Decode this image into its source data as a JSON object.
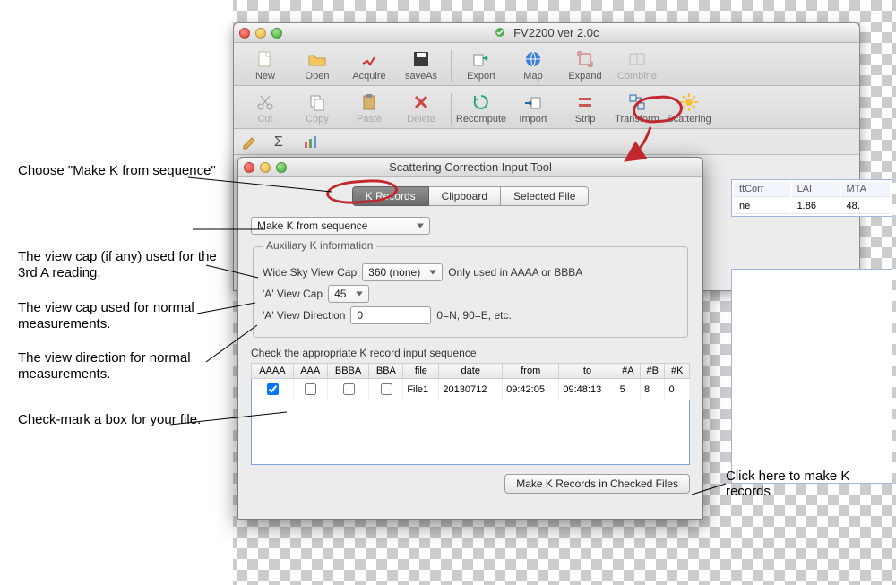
{
  "main_window": {
    "title": "FV2200 ver 2.0c",
    "toolbars": [
      [
        {
          "id": "new",
          "label": "New"
        },
        {
          "id": "open",
          "label": "Open"
        },
        {
          "id": "acquire",
          "label": "Acquire"
        },
        {
          "id": "saveAs",
          "label": "saveAs"
        },
        {
          "sep": true
        },
        {
          "id": "export",
          "label": "Export"
        },
        {
          "id": "map",
          "label": "Map"
        },
        {
          "id": "expand",
          "label": "Expand"
        },
        {
          "id": "combine",
          "label": "Combine",
          "disabled": true
        }
      ],
      [
        {
          "id": "cut",
          "label": "Cut",
          "disabled": true
        },
        {
          "id": "copy",
          "label": "Copy",
          "disabled": true
        },
        {
          "id": "paste",
          "label": "Paste",
          "disabled": true
        },
        {
          "id": "delete",
          "label": "Delete",
          "disabled": true
        },
        {
          "sep": true
        },
        {
          "id": "recompute",
          "label": "Recompute"
        },
        {
          "id": "import",
          "label": "Import"
        },
        {
          "id": "strip",
          "label": "Strip"
        },
        {
          "id": "transform",
          "label": "Transform"
        },
        {
          "id": "scattering",
          "label": "Scattering"
        }
      ]
    ],
    "results_table": {
      "headers": [
        "ttCorr",
        "LAI",
        "MTA"
      ],
      "row": [
        "ne",
        "1.86",
        "48."
      ]
    }
  },
  "dialog": {
    "title": "Scattering Correction Input Tool",
    "tabs": [
      "K Records",
      "Clipboard",
      "Selected File"
    ],
    "active_tab": 0,
    "make_from": "Make K from sequence",
    "aux": {
      "legend": "Auxiliary K information",
      "wide_label": "Wide Sky View Cap",
      "wide_value": "360 (none)",
      "wide_note": "Only used in AAAA or BBBA",
      "a_cap_label": "'A' View Cap",
      "a_cap_value": "45",
      "a_dir_label": "'A' View Direction",
      "a_dir_value": "0",
      "a_dir_note": "0=N, 90=E, etc."
    },
    "grid": {
      "prompt": "Check the appropriate K record input sequence",
      "headers": [
        "AAAA",
        "AAA",
        "BBBA",
        "BBA",
        "file",
        "date",
        "from",
        "to",
        "#A",
        "#B",
        "#K"
      ],
      "rows": [
        {
          "AAAA": true,
          "AAA": false,
          "BBBA": false,
          "BBA": false,
          "file": "File1",
          "date": "20130712",
          "from": "09:42:05",
          "to": "09:48:13",
          "nA": "5",
          "nB": "8",
          "nK": "0"
        }
      ]
    },
    "make_button": "Make K Records in Checked Files"
  },
  "annotations": {
    "a1": "Choose \"Make K from sequence\"",
    "a2": "The view cap (if any) used for the 3rd A reading.",
    "a3": "The view cap used for normal measurements.",
    "a4": "The view direction for normal measurements.",
    "a5": "Check-mark a box for your file.",
    "right": "Click here to make K records"
  }
}
